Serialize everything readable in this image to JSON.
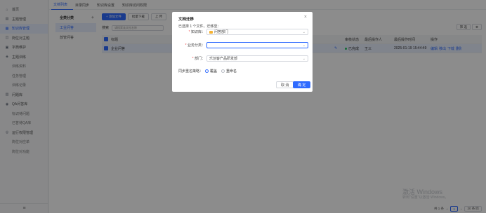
{
  "sidebar": {
    "items": [
      {
        "label": "首页",
        "icon": "home-icon",
        "glyph": "⌂"
      },
      {
        "label": "主题管理",
        "icon": "topic-icon",
        "glyph": "▤"
      },
      {
        "label": "知识库管理",
        "icon": "knowledge-base-icon",
        "glyph": "▦",
        "active": true
      },
      {
        "label": "岗位对主题",
        "icon": "position-icon",
        "glyph": "◫"
      },
      {
        "label": "字典维护",
        "icon": "dictionary-icon",
        "glyph": "▣"
      },
      {
        "label": "主题训练",
        "icon": "training-icon",
        "glyph": "◈"
      },
      {
        "label": "训练资料",
        "sub": true
      },
      {
        "label": "任务管理",
        "sub": true
      },
      {
        "label": "训练记录",
        "sub": true
      },
      {
        "label": "问题库",
        "icon": "question-bank-icon",
        "glyph": "▥"
      },
      {
        "label": "QA问答库",
        "icon": "qa-icon",
        "glyph": "◉"
      },
      {
        "label": "标识待问题",
        "sub": true
      },
      {
        "label": "已答待QA库",
        "sub": true
      },
      {
        "label": "运行权限管理",
        "icon": "permission-icon",
        "glyph": "◎"
      },
      {
        "label": "岗位对应单",
        "sub": true
      },
      {
        "label": "岗位对功能",
        "sub": true
      }
    ],
    "collapse_icon": "≡"
  },
  "tabs": [
    "文档列表",
    "目录同步",
    "知识库设置",
    "知识库访问权限"
  ],
  "categories": {
    "title": "全类分类",
    "items": [
      "工业问答",
      "放管问答"
    ]
  },
  "toolbar": {
    "add": "+ 添加文件",
    "batch_download": "批量下载",
    "move": "上 传"
  },
  "search": {
    "label": "搜索",
    "placeholder": "请搜索该文档名称"
  },
  "filter": {
    "search_btn": "筛 选"
  },
  "table": {
    "headers": [
      "标题",
      "",
      "审核状态",
      "最后操作人",
      "最后操作时间",
      "操作"
    ],
    "rows": [
      {
        "title": "企业问答",
        "status": "已完成",
        "operator": "王三",
        "time": "2025-01-19 15:44:49",
        "actions": [
          "编辑",
          "移出",
          "下载",
          "删除"
        ]
      }
    ]
  },
  "watermark": {
    "line1": "激活 Windows",
    "line2": "转到\"设置\"以激活 Windows。"
  },
  "pager": {
    "total": "共 1 条",
    "page": "1",
    "size": "20 条/页"
  },
  "dialog": {
    "title": "文档迁移",
    "selected": "已选择 1 个文件，迁移至：",
    "fields": [
      {
        "label": "知识库：",
        "value": "问答部门",
        "placeholder": "",
        "icon": "folder-icon"
      },
      {
        "label": "业务分类：",
        "value": "",
        "placeholder": ""
      },
      {
        "label": "部门：",
        "value": "乐创客产品研发部",
        "placeholder": ""
      }
    ],
    "strategy_label": "同步重名策略：",
    "strategy_options": [
      "覆盖",
      "重命名"
    ],
    "strategy_selected": 0,
    "cancel": "取 消",
    "confirm": "确 定"
  }
}
